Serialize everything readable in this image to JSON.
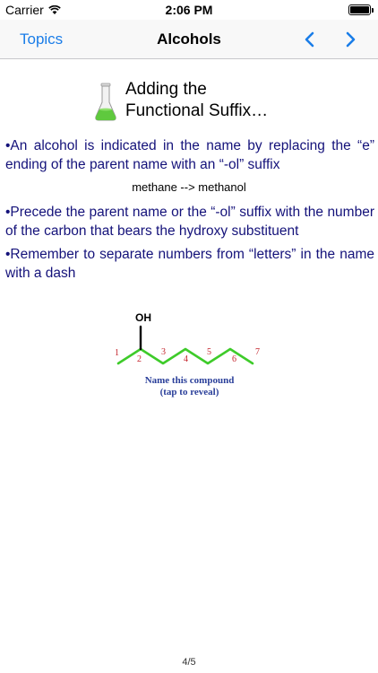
{
  "status": {
    "carrier": "Carrier",
    "time": "2:06 PM",
    "battery_level": 1.0
  },
  "nav": {
    "back_label": "Topics",
    "title": "Alcohols",
    "prev_icon": "chevron-left-icon",
    "next_icon": "chevron-right-icon",
    "accent": "#1a7de8"
  },
  "content": {
    "heading_line1": "Adding the",
    "heading_line2": "Functional Suffix…",
    "heading_icon": "flask-icon",
    "bullet1": "•An alcohol is indicated in the name by replacing the “e” ending of the parent name with an “-ol” suffix",
    "example": "methane --> methanol",
    "bullet2": "•Precede the parent name or the “-ol” suffix with the number of the carbon that bears the hydroxy substituent",
    "bullet3": "•Remember to separate numbers from “letters” in the name with a dash",
    "text_color": "#14127a"
  },
  "structure": {
    "substituent": "OH",
    "carbon_numbers": [
      "1",
      "2",
      "3",
      "4",
      "5",
      "6",
      "7"
    ],
    "caption_line1": "Name this compound",
    "caption_line2": "(tap to reveal)",
    "bond_color": "#3ecb2a",
    "number_color": "#c4252d"
  },
  "footer": {
    "page": "4/5"
  }
}
